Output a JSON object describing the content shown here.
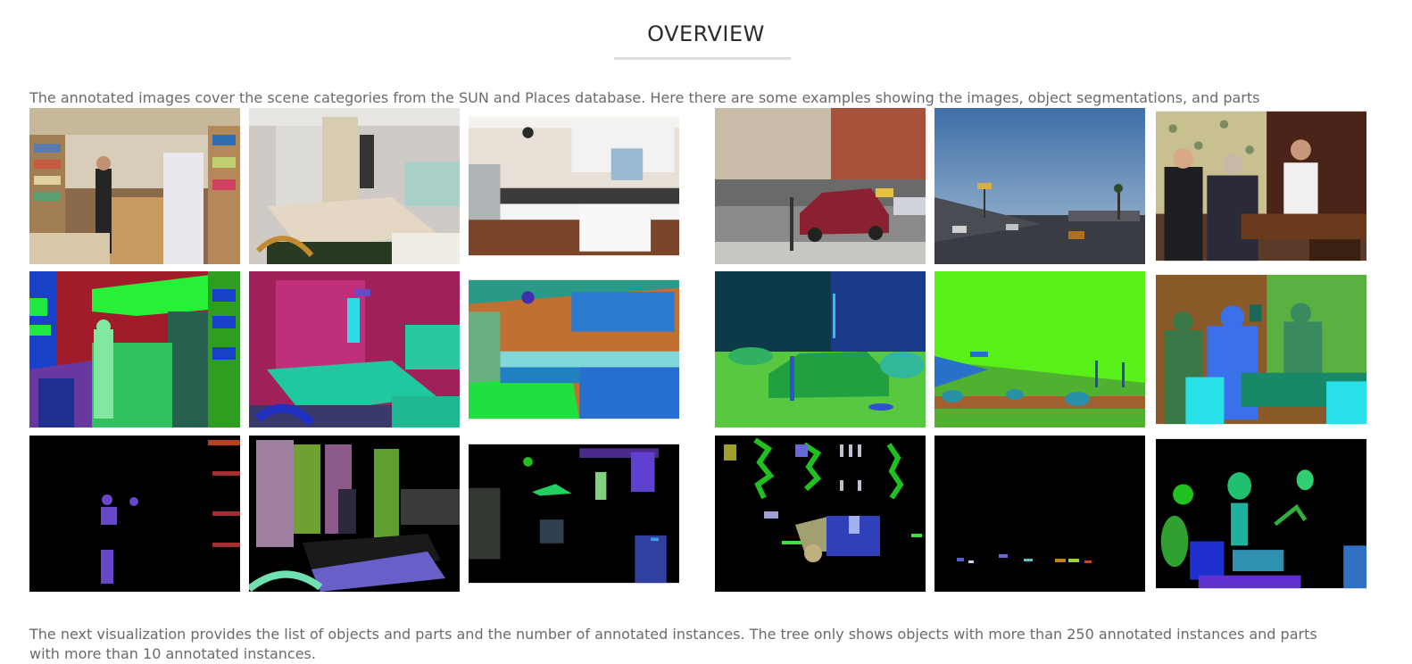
{
  "section": {
    "title": "OVERVIEW",
    "intro": "The annotated images cover the scene categories from the SUN and Places database. Here there are some examples showing the images, object segmentations, and parts segmentations:",
    "outro": "The next visualization provides the list of objects and parts and the number of annotated instances. The tree only shows objects with more than 250 annotated instances and parts with more than 10 annotated instances."
  },
  "gallery": {
    "rows": [
      "image",
      "object-segmentation",
      "parts-segmentation"
    ],
    "scenes": [
      "bookstore",
      "bedroom",
      "kitchen",
      "street",
      "highway",
      "bar"
    ]
  }
}
